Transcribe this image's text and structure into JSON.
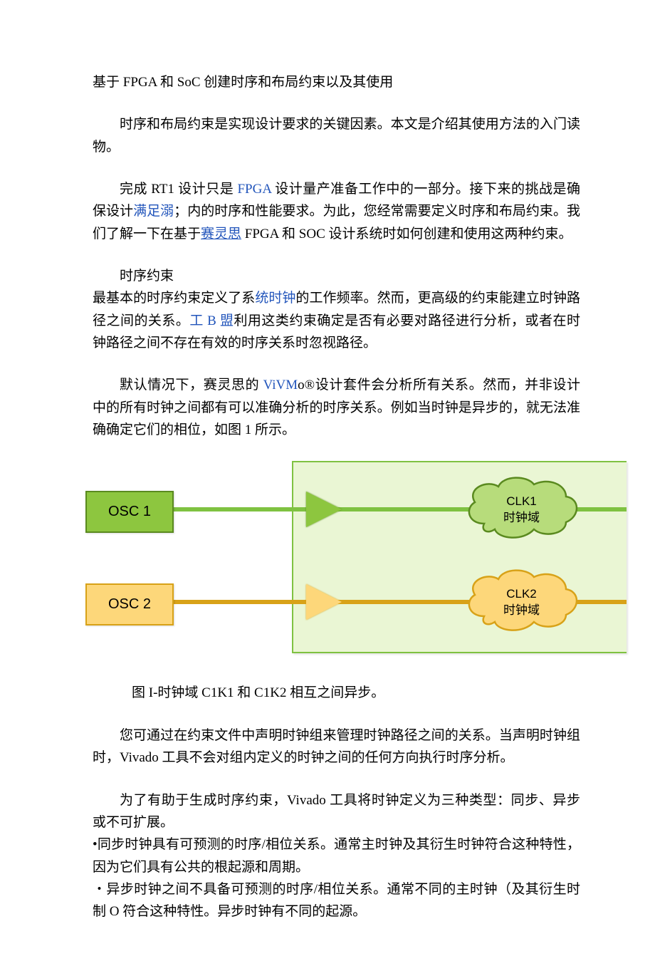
{
  "title": "基于 FPGA 和 SoC 创建时序和布局约束以及其使用",
  "p1": "时序和布局约束是实现设计要求的关键因素。本文是介绍其使用方法的入门读物。",
  "p2a": "完成 RT1 设计只是 ",
  "p2_link1": "FPGA",
  "p2b": " 设计量产准备工作中的一部分。接下来的挑战是确保设计",
  "p2_link2": "满足溺",
  "p2c": "；内的时序和性能要求。为此，您经常需要定义时序和布局约束。我们了解一下在基于",
  "p2_link3": "赛灵思",
  "p2d": " FPGA 和 SOC 设计系统时如何创建和使用这两种约束。",
  "h_timing": "时序约束",
  "p3a": "最基本的时序约束定义了系",
  "p3_link1": "统时钟",
  "p3b": "的工作频率。然而，更高级的约束能建立时钟路径之间的关系。",
  "p3_link2": "工 B 盟",
  "p3c": "利用这类约束确定是否有必要对路径进行分析，或者在时钟路径之间不存在有效的时序关系时忽视路径。",
  "p4a": "默认情况下，赛灵思的 ",
  "p4_link1": "ViVM",
  "p4b": "o®设计套件会分析所有关系。然而，并非设计中的所有时钟之间都有可以准确分析的时序关系。例如当时钟是异步的，就无法准确确定它们的相位，如图 1 所示。",
  "diagram": {
    "osc1": "OSC 1",
    "osc2": "OSC 2",
    "clk1_a": "CLK1",
    "clk1_b": "时钟域",
    "clk2_a": "CLK2",
    "clk2_b": "时钟域"
  },
  "caption": "图 I-时钟域 C1K1 和 C1K2 相互之间异步。",
  "p5": "您可通过在约束文件中声明时钟组来管理时钟路径之间的关系。当声明时钟组时，Vivado 工具不会对组内定义的时钟之间的任何方向执行时序分析。",
  "p6": "为了有助于生成时序约束，Vivado 工具将时钟定义为三种类型：同步、异步或不可扩展。",
  "b1": "•同步时钟具有可预测的时序/相位关系。通常主时钟及其衍生时钟符合这种特性，因为它们具有公共的根起源和周期。",
  "b2": "・异步时钟之间不具备可预测的时序/相位关系。通常不同的主时钟（及其衍生时制 O 符合这种特性。异步时钟有不同的起源。"
}
